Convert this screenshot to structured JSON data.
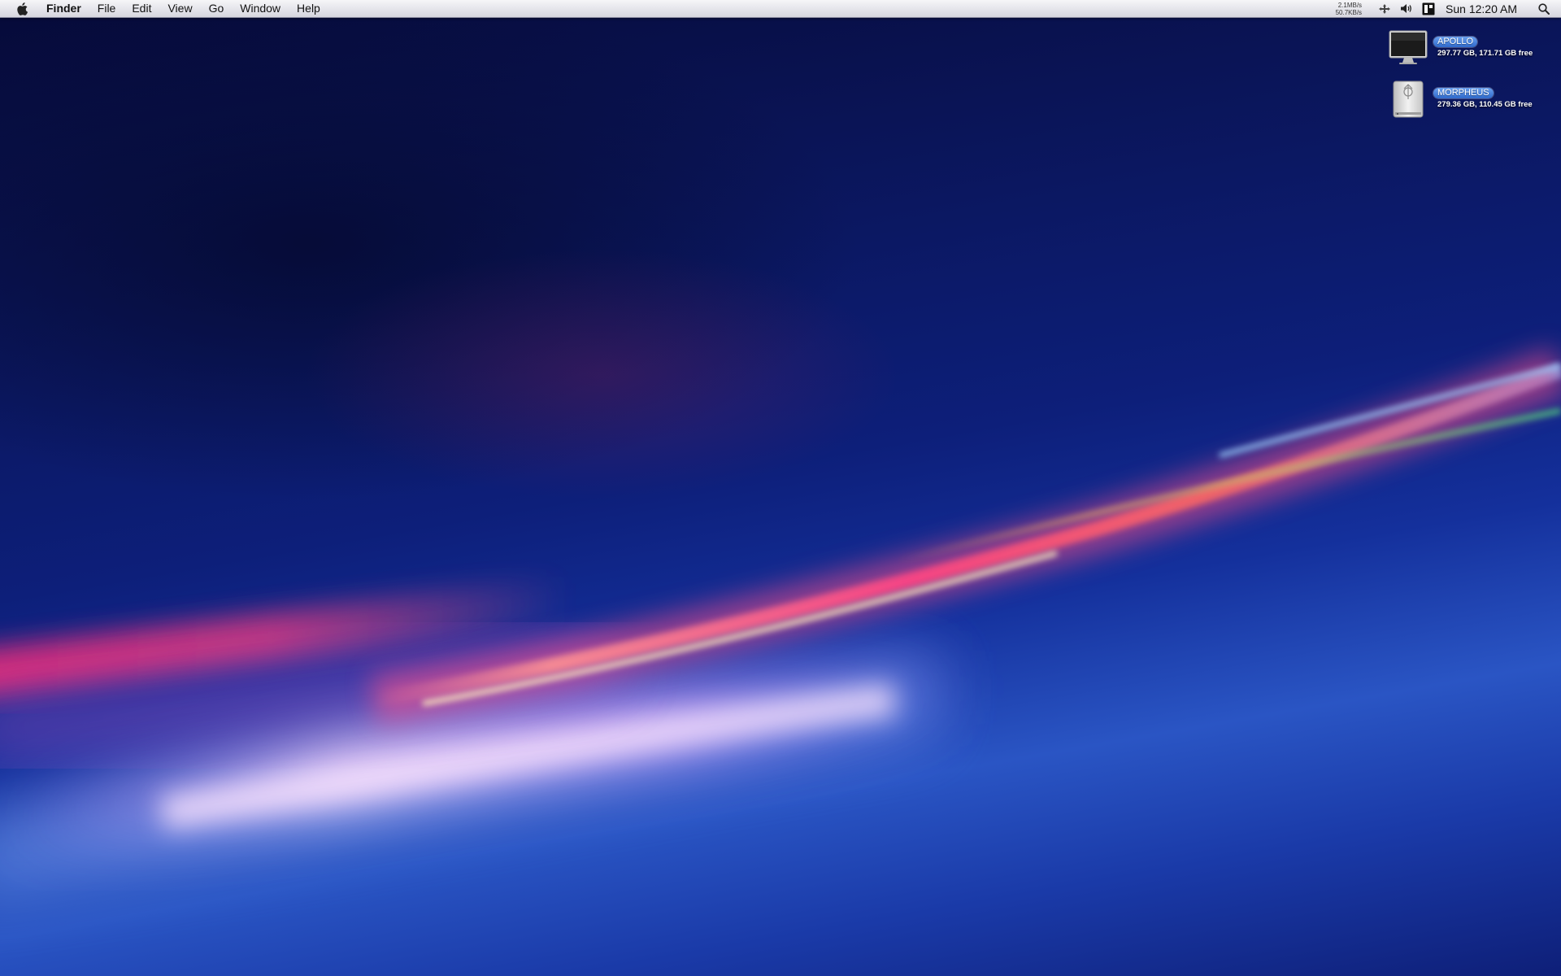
{
  "menubar": {
    "apple_icon": "apple-icon",
    "app_name": "Finder",
    "items": [
      "File",
      "Edit",
      "View",
      "Go",
      "Window",
      "Help"
    ],
    "network": {
      "upload": "2.1MB/s",
      "download": "50.7KB/s"
    },
    "status_icons": [
      "network-activity-icon",
      "volume-icon",
      "display-icon"
    ],
    "clock": "Sun 12:20 AM",
    "spotlight_icon": "spotlight-icon"
  },
  "desktop": {
    "drives": [
      {
        "name": "APOLLO",
        "info": "297.77 GB, 171.71 GB free",
        "icon": "monitor-drive-icon"
      },
      {
        "name": "MORPHEUS",
        "info": "279.36 GB, 110.45 GB free",
        "icon": "firewire-drive-icon"
      }
    ]
  },
  "colors": {
    "selection": "#3f7bd9",
    "wallpaper_dark": "#0a1456",
    "wallpaper_light": "#2a55c4",
    "streak_pink": "#ff3d7f"
  }
}
